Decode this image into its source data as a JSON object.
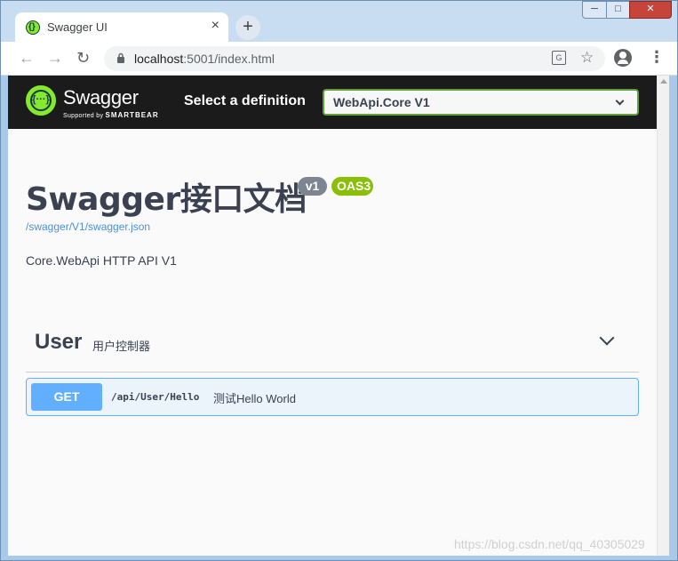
{
  "browser": {
    "tab_title": "Swagger UI",
    "tab_close": "×",
    "new_tab": "+",
    "url_host": "localhost",
    "url_path": ":5001/index.html",
    "window_min": "─",
    "window_max": "□",
    "window_close": "✕"
  },
  "topbar": {
    "brand": "Swagger",
    "supported_by": "Supported by",
    "smartbear": "SMARTBEAR",
    "select_label": "Select a definition",
    "selected_definition": "WebApi.Core V1"
  },
  "info": {
    "title": "Swagger接口文档",
    "version_badge": "v1",
    "oas_badge": "OAS3",
    "spec_link": "/swagger/V1/swagger.json",
    "description": "Core.WebApi HTTP API V1"
  },
  "tag": {
    "name": "User",
    "description": "用户控制器"
  },
  "operation": {
    "method": "GET",
    "path": "/api/User/Hello",
    "summary": "测试Hello World"
  },
  "watermark": "https://blog.csdn.net/qq_40305029",
  "colors": {
    "topbar_bg": "#1b1b1b",
    "swagger_green": "#85ea2d",
    "get_blue": "#61affe",
    "oas_green": "#89bf04",
    "version_gray": "#7d8492",
    "link_blue": "#4990e2"
  }
}
